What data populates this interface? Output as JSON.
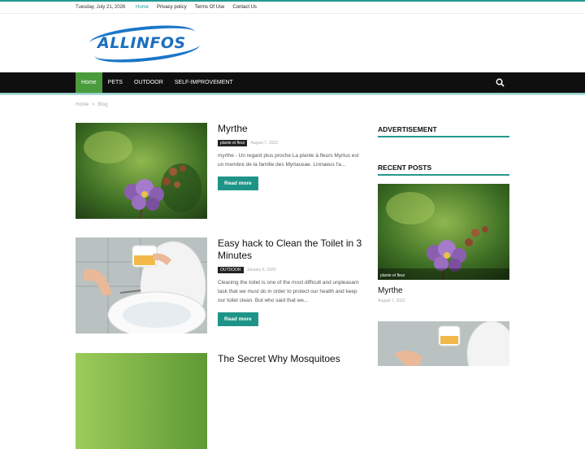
{
  "topbar": {
    "date": "Tuesday, July 21, 2026",
    "links": [
      "Home",
      "Privacy policy",
      "Terms Of Use",
      "Contact Us"
    ]
  },
  "logo": {
    "text": "ALLINFOS"
  },
  "nav": {
    "items": [
      "Home",
      "Pets",
      "Outdoor",
      "Self-improvement"
    ],
    "search_icon": "search-icon"
  },
  "breadcrumb": {
    "home": "Home",
    "sep": ">",
    "current": "Blog"
  },
  "posts": [
    {
      "title": "Myrthe",
      "category": "plante et fleur",
      "date": "August 7, 2022",
      "excerpt": "myrthe - Un regard plus proche La plante à fleurs Myrtus est un membre de la famille des Myrtaceae. Linnaeus l'a...",
      "read_more": "Read more"
    },
    {
      "title": "Easy hack to Clean the Toilet in 3 Minutes",
      "category": "OUTDOOR",
      "date": "January 6, 2020",
      "excerpt": "Cleaning the toilet is one of the most difficult and unpleasant  task that we must do in order to protect our health and keep our toilet clean. But who said that we...",
      "read_more": "Read more"
    },
    {
      "title": "The Secret Why Mosquitoes"
    }
  ],
  "sidebar": {
    "advertisement": "ADVERTISEMENT",
    "recent_posts": "RECENT POSTS",
    "recent": [
      {
        "category": "plante et fleur",
        "title": "Myrthe",
        "date": "August 7, 2022"
      }
    ]
  },
  "colors": {
    "accent": "#25998f",
    "nav_bg": "#0f0f0f",
    "nav_active": "#4a9b3c",
    "button": "#1e9488"
  }
}
